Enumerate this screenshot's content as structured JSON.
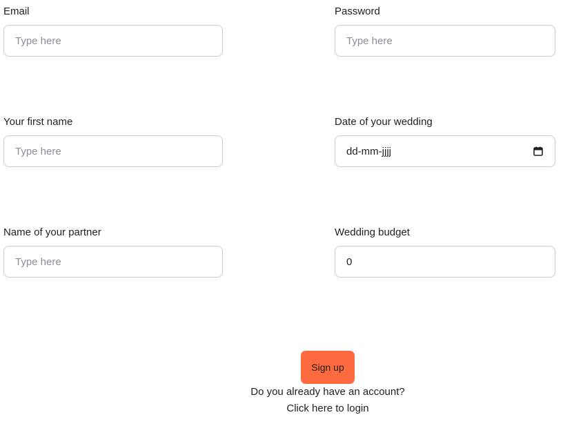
{
  "form": {
    "email": {
      "label": "Email",
      "placeholder": "Type here",
      "value": ""
    },
    "password": {
      "label": "Password",
      "placeholder": "Type here",
      "value": ""
    },
    "first_name": {
      "label": "Your first name",
      "placeholder": "Type here",
      "value": ""
    },
    "wedding_date": {
      "label": "Date of your wedding",
      "display": "dd-mm-jjjj",
      "icon": "calendar-icon"
    },
    "partner_name": {
      "label": "Name of your partner",
      "placeholder": "Type here",
      "value": ""
    },
    "budget": {
      "label": "Wedding budget",
      "value": "0"
    }
  },
  "actions": {
    "signup_label": "Sign up",
    "account_question": "Do you already have an account?",
    "login_link": "Click here to login"
  },
  "colors": {
    "accent": "#fe6a40",
    "input_border": "#c9ccd1",
    "placeholder": "#8a8f98"
  }
}
